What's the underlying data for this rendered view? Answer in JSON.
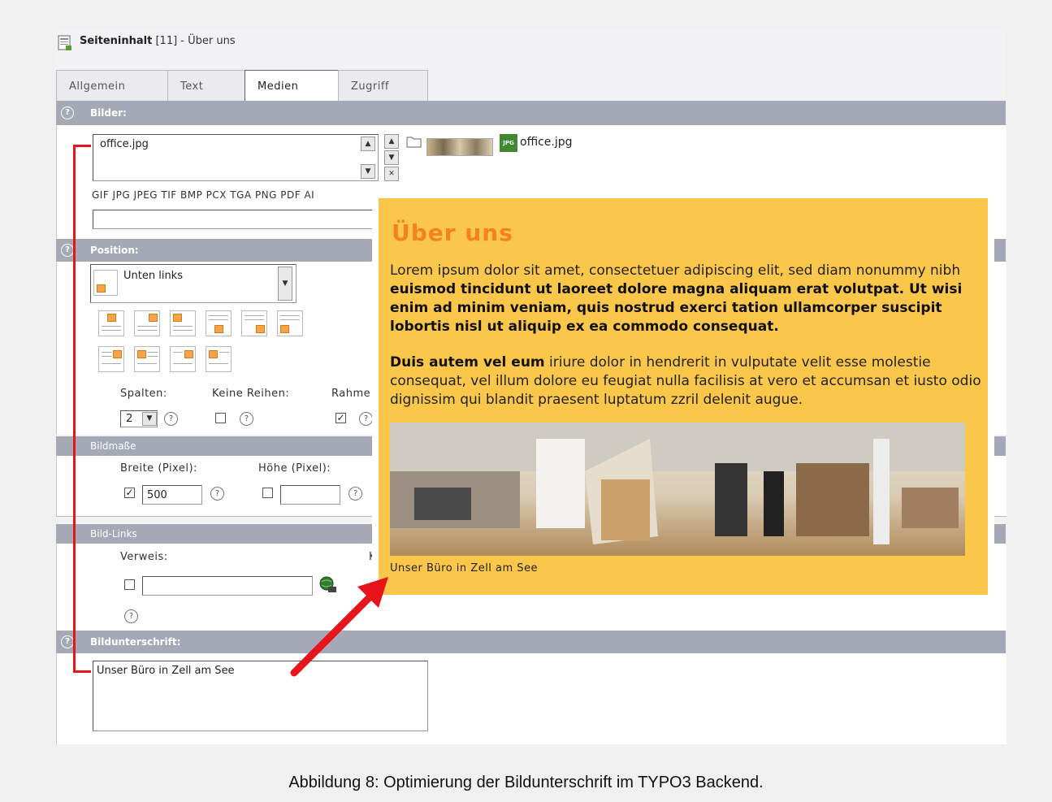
{
  "header": {
    "title_bold": "Seiteninhalt",
    "title_rest": " [11] - Über uns",
    "icon": "content-element-icon"
  },
  "tabs": [
    {
      "label": "Allgemein",
      "active": false
    },
    {
      "label": "Text",
      "active": false
    },
    {
      "label": "Medien",
      "active": true
    },
    {
      "label": "Zugriff",
      "active": false
    }
  ],
  "bilder": {
    "section_label": "Bilder:",
    "selected_file": "office.jpg",
    "thumb_file_label": "office.jpg",
    "allowed_types": "GIF JPG JPEG TIF BMP PCX TGA PNG PDF AI",
    "upload_value": ""
  },
  "position": {
    "section_label": "Position:",
    "selected": "Unten links",
    "spalten_label": "Spalten:",
    "spalten_value": "2",
    "keine_reihen_label": "Keine Reihen:",
    "keine_reihen_checked": false,
    "rahmen_label": "Rahme",
    "rahmen_checked": true
  },
  "bildmasse": {
    "section_label": "Bildmaße",
    "breite_label": "Breite (Pixel):",
    "breite_checked": true,
    "breite_value": "500",
    "hoehe_label": "Höhe (Pixel):",
    "hoehe_checked": false,
    "hoehe_value": ""
  },
  "bildlinks": {
    "section_label": "Bild-Links",
    "verweis_label": "Verweis:",
    "verweis_value": "",
    "verweis_checked": false,
    "cut_label": "K"
  },
  "bildunterschrift": {
    "section_label": "Bildunterschrift:",
    "value": "Unser Büro in Zell am See"
  },
  "preview": {
    "title": "Über uns",
    "p1_plain": "Lorem ipsum dolor sit amet, consectetuer adipiscing elit, sed diam nonummy nibh ",
    "p1_bold": "euismod tincidunt ut laoreet dolore magna aliquam erat volutpat. Ut wisi enim ad minim veniam, quis nostrud exerci tation ullamcorper suscipit lobortis nisl ut aliquip ex ea commodo consequat.",
    "p2_bold": "Duis autem vel eum",
    "p2_plain": " iriure dolor in hendrerit in vulputate velit esse molestie consequat, vel illum dolore eu feugiat nulla facilisis at vero et accumsan et iusto odio dignissim qui blandit praesent luptatum zzril delenit augue.",
    "image_caption": "Unser Büro in Zell am See"
  },
  "figure_caption": "Abbildung 8: Optimierung der Bildunterschrift im TYPO3 Backend.",
  "colors": {
    "section_bar": "#a4a9b5",
    "preview_bg": "#fbc74b",
    "preview_title": "#f58220",
    "annotation": "#e8141b"
  }
}
